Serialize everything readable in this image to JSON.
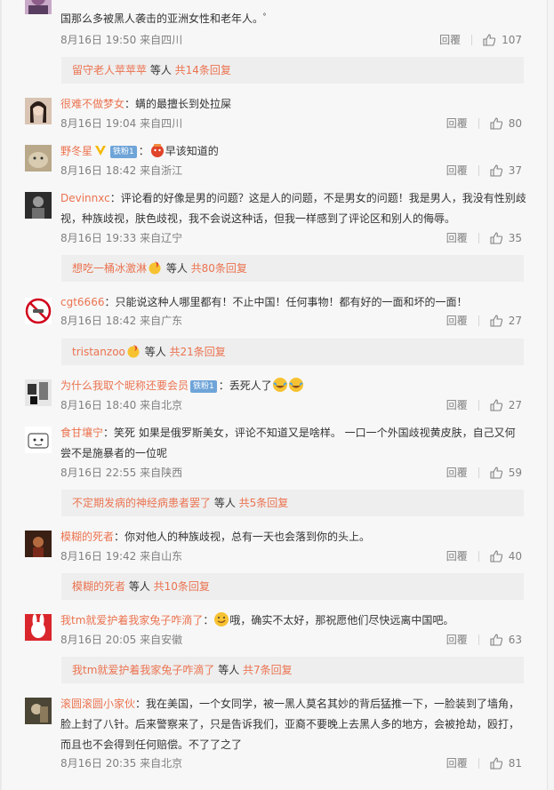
{
  "comments": [
    {
      "username": "",
      "text": "国那么多被黑人袭击的亚洲女性和老年人。",
      "text_suffix": "ﾟ",
      "time": "8月16日 19:50",
      "source": "来自四川",
      "reply": "回覆",
      "likes": "107",
      "sub": {
        "user": "留守老人苹苹苹",
        "mid": " 等人 ",
        "count": "共14条回复"
      }
    },
    {
      "username": "很难不做梦女",
      "sep": "：",
      "text": "螨的最擅长到处拉屎",
      "time": "8月16日 19:04",
      "source": "来自四川",
      "reply": "回覆",
      "likes": "80"
    },
    {
      "username": "野冬星",
      "tag": "铁粉1",
      "sep": "：",
      "text": "早该知道的",
      "time": "8月16日 18:42",
      "source": "来自浙江",
      "reply": "回覆",
      "likes": "37"
    },
    {
      "username": "Devinnxc",
      "sep": "：",
      "text": "评论看的好像是男的问题？这是人的问题，不是男女的问题！我是男人，我没有性别歧",
      "text2": "视，种族歧视，肤色歧视，我不会说这种话，但我一样感到了评论区和别人的侮辱。",
      "time": "8月16日 19:33",
      "source": "来自辽宁",
      "reply": "回覆",
      "likes": "35",
      "sub": {
        "user": "想吃一桶冰激淋",
        "mid": " 等人 ",
        "count": "共80条回复"
      }
    },
    {
      "username": "cgt6666",
      "sep": "：",
      "text": "只能说这种人哪里都有！不止中国！任何事物！都有好的一面和坏的一面！",
      "time": "8月16日 18:42",
      "source": "来自广东",
      "reply": "回覆",
      "likes": "27",
      "sub": {
        "user": "tristanzoo",
        "mid": " 等人 ",
        "count": "共21条回复"
      }
    },
    {
      "username": "为什么我取个昵称还要会员",
      "tag": "铁粉1",
      "sep": "：",
      "text": "丢死人了",
      "time": "8月16日 18:40",
      "source": "来自北京",
      "reply": "回覆",
      "likes": "27"
    },
    {
      "username": "食甘壤宁",
      "sep": "：",
      "text": "笑死 如果是俄罗斯美女，评论不知道又是啥样。 一口一个外国歧视黄皮肤，自己又何",
      "text2": "尝不是施暴者的一位呢",
      "time": "8月16日 22:55",
      "source": "来自陕西",
      "reply": "回覆",
      "likes": "59",
      "sub": {
        "user": "不定期发病的神经病患者罢了",
        "mid": " 等人 ",
        "count": "共5条回复"
      }
    },
    {
      "username": "模糊的死者",
      "sep": "：",
      "text": "你对他人的种族歧视，总有一天也会落到你的头上。",
      "time": "8月16日 19:42",
      "source": "来自山东",
      "reply": "回覆",
      "likes": "40",
      "sub": {
        "user": "模糊的死者",
        "mid": " 等人 ",
        "count": "共10条回复"
      }
    },
    {
      "username": "我tm就爱护着我家兔子咋滴了",
      "sep": "：",
      "text": "哦，确实不太好，那祝愿他们尽快远离中国吧。",
      "time": "8月16日 20:05",
      "source": "来自安徽",
      "reply": "回覆",
      "likes": "63",
      "sub": {
        "user": "我tm就爱护着我家兔子咋滴了",
        "mid": " 等人 ",
        "count": "共7条回复"
      }
    },
    {
      "username": "滚圆滚圆小家伙",
      "sep": "：",
      "text": "我在美国，一个女同学，被一黑人莫名其妙的背后猛推一下，一脸装到了墙角，",
      "text2": "脸上封了八针。后来警察来了，只是告诉我们，亚裔不要晚上去黑人多的地方，会被抢劫，殴打，",
      "text3": "而且也不会得到任何赔偿。不了了之了",
      "time": "8月16日 20:35",
      "source": "来自北京",
      "reply": "回覆",
      "likes": "81"
    }
  ],
  "colors": {
    "link": "#eb7350",
    "meta": "#808080",
    "sub_bg": "#eeeeee",
    "badge": "#6ea4d8"
  },
  "icons": {
    "like": "thumbs-up-icon",
    "vip": "v-badge-icon"
  }
}
